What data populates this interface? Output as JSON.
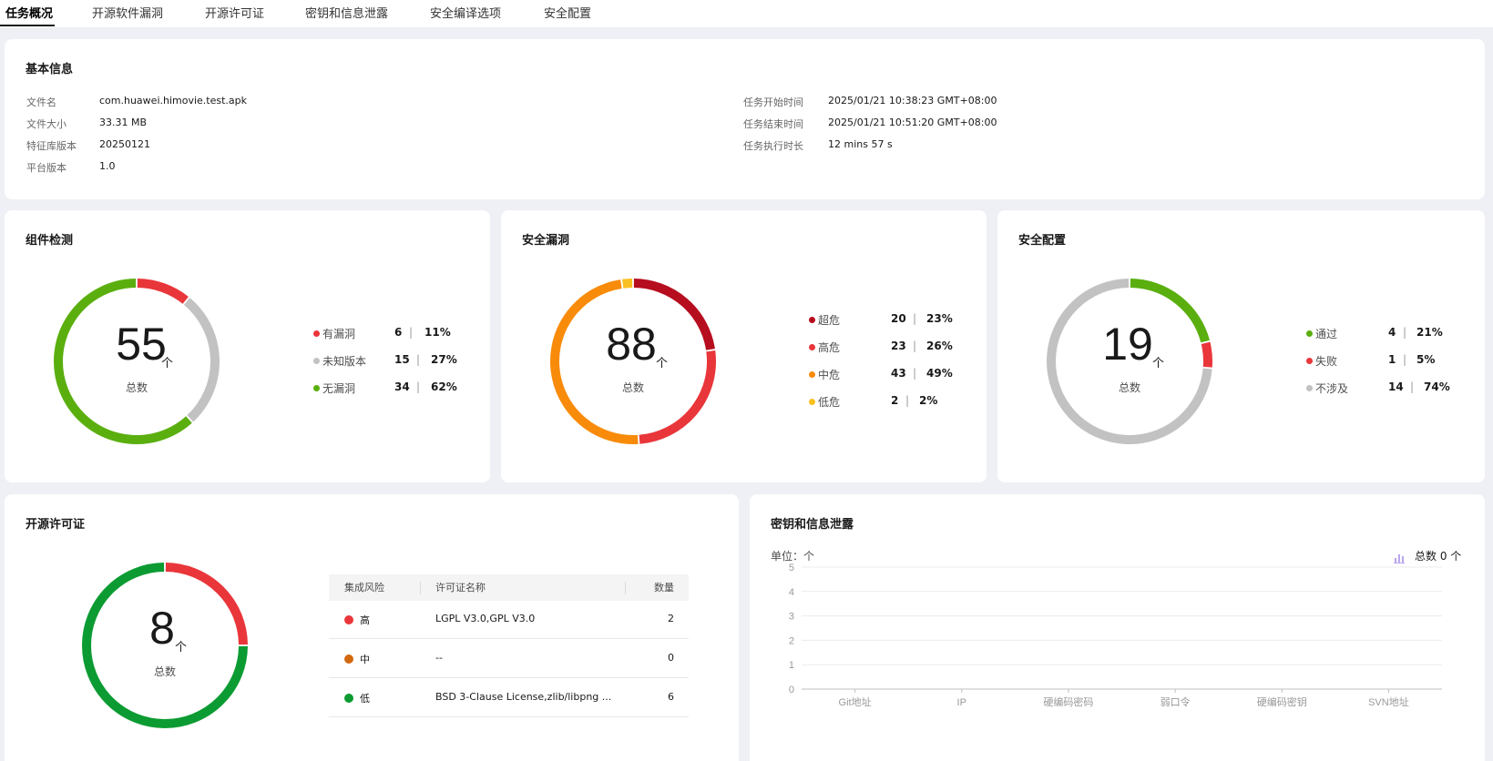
{
  "tabs": [
    {
      "label": "任务概况",
      "active": true
    },
    {
      "label": "开源软件漏洞",
      "active": false
    },
    {
      "label": "开源许可证",
      "active": false
    },
    {
      "label": "密钥和信息泄露",
      "active": false
    },
    {
      "label": "安全编译选项",
      "active": false
    },
    {
      "label": "安全配置",
      "active": false
    }
  ],
  "basic_info": {
    "title": "基本信息",
    "left": [
      {
        "label": "文件名",
        "value": "com.huawei.himovie.test.apk"
      },
      {
        "label": "文件大小",
        "value": "33.31 MB"
      },
      {
        "label": "特征库版本",
        "value": "20250121"
      },
      {
        "label": "平台版本",
        "value": "1.0"
      }
    ],
    "right": [
      {
        "label": "任务开始时间",
        "value": "2025/01/21 10:38:23 GMT+08:00"
      },
      {
        "label": "任务结束时间",
        "value": "2025/01/21 10:51:20 GMT+08:00"
      },
      {
        "label": "任务执行时长",
        "value": "12 mins 57 s"
      }
    ]
  },
  "component": {
    "title": "组件检测",
    "total": "55",
    "unit": "个",
    "total_label": "总数",
    "items": [
      {
        "label": "有漏洞",
        "count": "6",
        "pct": "11%",
        "color": "#e9363a"
      },
      {
        "label": "未知版本",
        "count": "15",
        "pct": "27%",
        "color": "#c2c2c2"
      },
      {
        "label": "无漏洞",
        "count": "34",
        "pct": "62%",
        "color": "#5aaf0f"
      }
    ]
  },
  "vuln": {
    "title": "安全漏洞",
    "total": "88",
    "unit": "个",
    "total_label": "总数",
    "items": [
      {
        "label": "超危",
        "count": "20",
        "pct": "23%",
        "color": "#b60e1e"
      },
      {
        "label": "高危",
        "count": "23",
        "pct": "26%",
        "color": "#e9363a"
      },
      {
        "label": "中危",
        "count": "43",
        "pct": "49%",
        "color": "#f98b0a"
      },
      {
        "label": "低危",
        "count": "2",
        "pct": "2%",
        "color": "#f8c020"
      }
    ]
  },
  "config": {
    "title": "安全配置",
    "total": "19",
    "unit": "个",
    "total_label": "总数",
    "items": [
      {
        "label": "通过",
        "count": "4",
        "pct": "21%",
        "color": "#5aaf0f"
      },
      {
        "label": "失败",
        "count": "1",
        "pct": "5%",
        "color": "#e9363a"
      },
      {
        "label": "不涉及",
        "count": "14",
        "pct": "74%",
        "color": "#c2c2c2"
      }
    ]
  },
  "license": {
    "title": "开源许可证",
    "total": "8",
    "unit": "个",
    "total_label": "总数",
    "columns": [
      "集成风险",
      "许可证名称",
      "数量"
    ],
    "rows": [
      {
        "risk": "高",
        "name": "LGPL V3.0,GPL V3.0",
        "qty": "2",
        "count": 2,
        "color": "#e9363a"
      },
      {
        "risk": "中",
        "name": "--",
        "qty": "0",
        "count": 0,
        "color": "#d1690f"
      },
      {
        "risk": "低",
        "name": "BSD 3-Clause License,zlib/libpng ...",
        "qty": "6",
        "count": 6,
        "color": "#0c9b32"
      }
    ]
  },
  "secrets": {
    "title": "密钥和信息泄露",
    "unit_label": "单位：个",
    "total_label": "总数 0 个",
    "chart_data": {
      "type": "bar",
      "categories": [
        "Git地址",
        "IP",
        "硬编码密码",
        "弱口令",
        "硬编码密钥",
        "SVN地址"
      ],
      "values": [
        0,
        0,
        0,
        0,
        0,
        0
      ],
      "yticks": [
        "5",
        "4",
        "3",
        "2",
        "1",
        "0"
      ],
      "ylim": [
        0,
        5
      ],
      "grid": true
    }
  }
}
